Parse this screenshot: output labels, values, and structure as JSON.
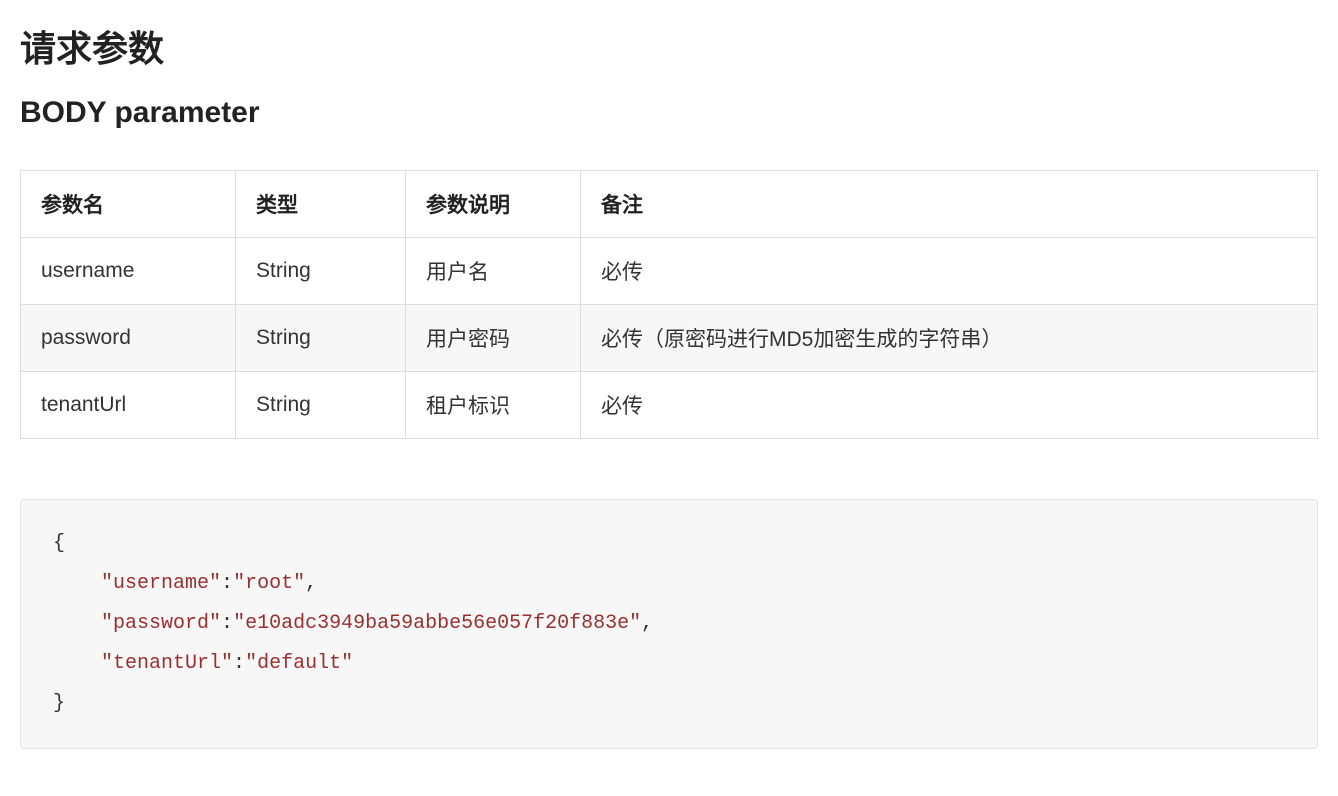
{
  "heading": "请求参数",
  "subheading": "BODY parameter",
  "table": {
    "headers": {
      "name": "参数名",
      "type": "类型",
      "desc": "参数说明",
      "note": "备注"
    },
    "rows": [
      {
        "name": "username",
        "type": "String",
        "desc": "用户名",
        "note": "必传"
      },
      {
        "name": "password",
        "type": "String",
        "desc": "用户密码",
        "note": "必传（原密码进行MD5加密生成的字符串）"
      },
      {
        "name": "tenantUrl",
        "type": "String",
        "desc": "租户标识",
        "note": "必传"
      }
    ]
  },
  "code": {
    "lines": [
      {
        "indent": 0,
        "plain": "{"
      },
      {
        "indent": 1,
        "key": "\"username\"",
        "sep": ":",
        "value": "\"root\"",
        "trail": ","
      },
      {
        "indent": 1,
        "key": "\"password\"",
        "sep": ":",
        "value": "\"e10adc3949ba59abbe56e057f20f883e\"",
        "trail": ","
      },
      {
        "indent": 1,
        "key": "\"tenantUrl\"",
        "sep": ":",
        "value": "\"default\"",
        "trail": ""
      },
      {
        "indent": 0,
        "plain": "}"
      }
    ]
  }
}
